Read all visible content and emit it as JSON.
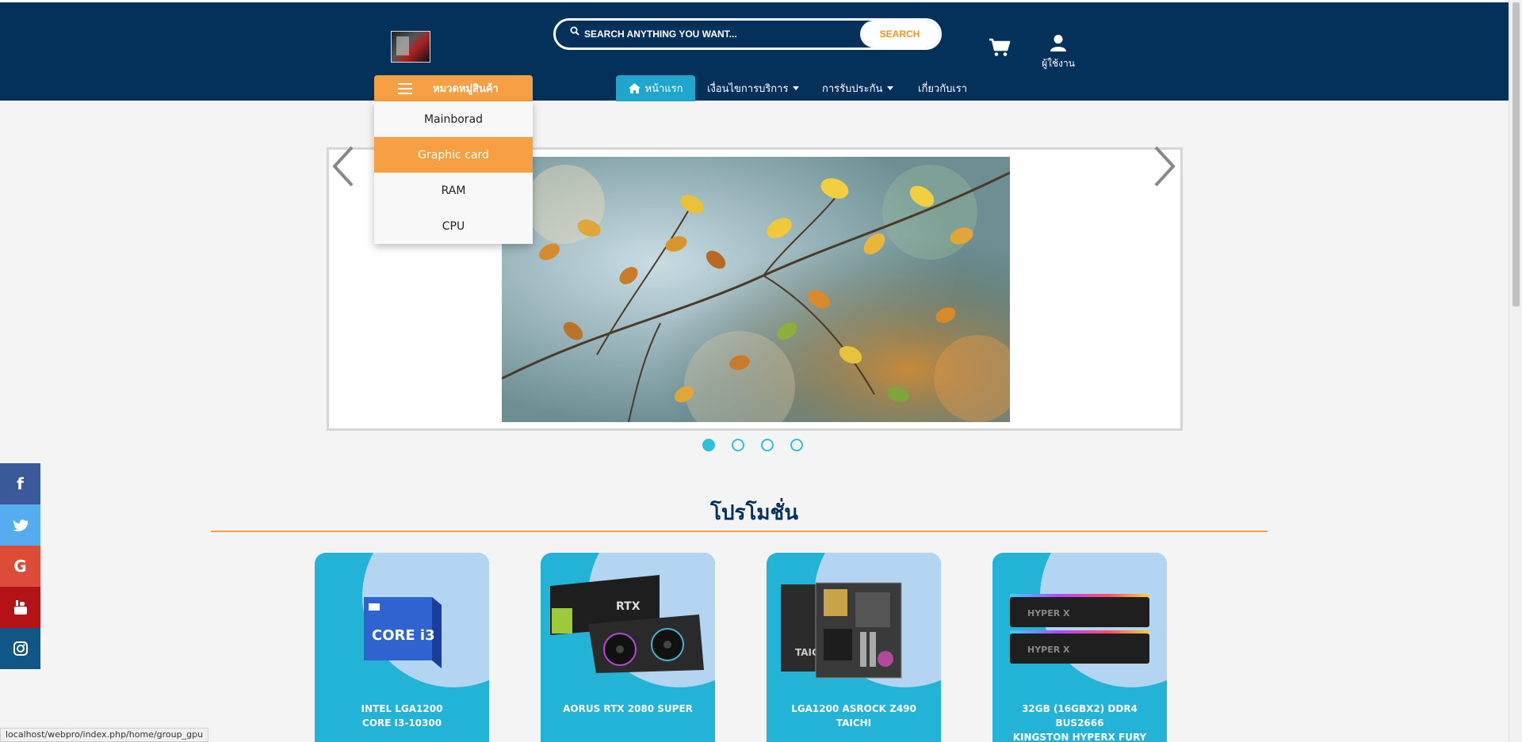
{
  "header": {
    "search_placeholder": "SEARCH ANYTHING YOU WANT...",
    "search_button": "SEARCH",
    "user_label": "ผู้ใช้งาน"
  },
  "nav": {
    "categories_label": "หมวดหมู่สินค้า",
    "home": "หน้าแรก",
    "terms": "เงื่อนไขการบริการ",
    "warranty": "การรับประกัน",
    "about": "เกี่ยวกับเรา"
  },
  "dropdown": {
    "items": [
      "Mainborad",
      "Graphic card",
      "RAM",
      "CPU"
    ],
    "active_index": 1
  },
  "carousel": {
    "slide_count": 4,
    "active_index": 0
  },
  "promotions": {
    "title": "โปรโมชั่น",
    "cards": [
      {
        "name_line1": "INTEL LGA1200",
        "name_line2": "CORE I3-10300"
      },
      {
        "name_line1": "AORUS RTX 2080 SUPER",
        "name_line2": ""
      },
      {
        "name_line1": "LGA1200 ASROCK Z490",
        "name_line2": "TAICHI"
      },
      {
        "name_line1": "32GB (16GBX2) DDR4 BUS2666",
        "name_line2": "KINGSTON HYPERX FURY"
      }
    ]
  },
  "product_art": {
    "card1_text": "CORE i3",
    "card2_text": "RTX",
    "card3_text": "TAICHI",
    "card4_text": "HYPER X"
  },
  "social": [
    "facebook-icon",
    "twitter-icon",
    "google-icon",
    "youtube-icon",
    "instagram-icon"
  ],
  "statusbar": {
    "url": "localhost/webpro/index.php/home/group_gpu"
  },
  "colors": {
    "header_bg": "#04315a",
    "accent_orange": "#f7a043",
    "accent_cyan": "#22b3d6",
    "card_bubble": "#b3d5f2"
  }
}
